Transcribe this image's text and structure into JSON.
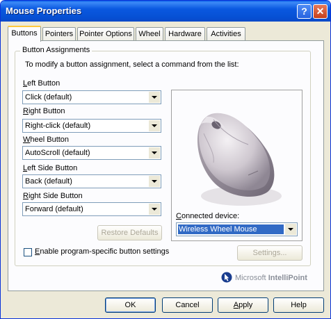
{
  "window": {
    "title": "Mouse Properties",
    "help_glyph": "?",
    "close_glyph": "✕"
  },
  "tabs": [
    "Buttons",
    "Pointers",
    "Pointer Options",
    "Wheel",
    "Hardware",
    "Activities"
  ],
  "group": {
    "title": "Button Assignments",
    "instructions": "To modify a button assignment, select a command from the list:"
  },
  "buttons": [
    {
      "label_key": "L",
      "label_rest": "eft Button",
      "value": "Click (default)"
    },
    {
      "label_key": "R",
      "label_rest": "ight Button",
      "value": "Right-click (default)"
    },
    {
      "label_key": "W",
      "label_rest": "heel Button",
      "value": "AutoScroll (default)"
    },
    {
      "label_key": "L",
      "label_rest": "eft Side Button",
      "value": "Back (default)"
    },
    {
      "label_key": "R",
      "label_rest": "ight Side Button",
      "value": "Forward (default)"
    }
  ],
  "restore_defaults": "Restore Defaults",
  "connected": {
    "label_key": "C",
    "label_rest": "onnected device:",
    "value": "Wireless Wheel Mouse"
  },
  "checkbox": {
    "label_key": "E",
    "label_rest": "nable program-specific button settings",
    "checked": false
  },
  "settings_button": "Settings...",
  "branding": {
    "company": "Microsoft",
    "product": "IntelliPoint"
  },
  "footer": {
    "ok": "OK",
    "cancel": "Cancel",
    "apply_key": "A",
    "apply_rest": "pply",
    "help": "Help"
  },
  "colors": {
    "titlebar": "#0a58e0",
    "dialog_bg": "#ece9d8",
    "selection": "#316ac5",
    "tab_highlight": "#ffc83c"
  },
  "icons": {
    "dropdown": "chevron-down-icon",
    "mouse": "mouse-image",
    "brand": "intellipoint-logo-icon"
  }
}
